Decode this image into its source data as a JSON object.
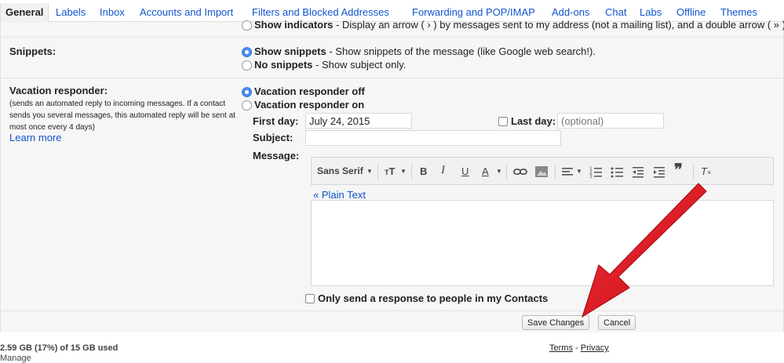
{
  "tabs": [
    {
      "label": "General",
      "active": true
    },
    {
      "label": "Labels"
    },
    {
      "label": "Inbox"
    },
    {
      "label": "Accounts and Import"
    },
    {
      "label": "Filters and Blocked Addresses"
    },
    {
      "label": "Forwarding and POP/IMAP"
    },
    {
      "label": "Add-ons"
    },
    {
      "label": "Chat"
    },
    {
      "label": "Labs"
    },
    {
      "label": "Offline"
    },
    {
      "label": "Themes"
    }
  ],
  "indicators": {
    "option_label": "Show indicators",
    "option_desc": " - Display an arrow ( › ) by messages sent to my address (not a mailing list), and a double arrow ( » ) b"
  },
  "snippets": {
    "title": "Snippets:",
    "show_label": "Show snippets",
    "show_desc": " - Show snippets of the message (like Google web search!).",
    "none_label": "No snippets",
    "none_desc": " - Show subject only."
  },
  "vacation": {
    "title": "Vacation responder:",
    "description": "(sends an automated reply to incoming messages. If a contact sends you several messages, this automated reply will be sent at most once every 4 days)",
    "learn_more": "Learn more",
    "off_label": "Vacation responder off",
    "on_label": "Vacation responder on",
    "first_day_label": "First day:",
    "first_day_value": "July 24, 2015",
    "last_day_label": "Last day:",
    "last_day_placeholder": "(optional)",
    "subject_label": "Subject:",
    "subject_value": "",
    "message_label": "Message:",
    "font_name": "Sans Serif",
    "plain_text_link": "« Plain Text",
    "contacts_only_label": "Only send a response to people in my Contacts"
  },
  "actions": {
    "save_label": "Save Changes",
    "cancel_label": "Cancel"
  },
  "footer": {
    "storage": "2.59 GB (17%) of 15 GB used",
    "manage": "Manage",
    "terms": "Terms",
    "separator": " - ",
    "privacy": "Privacy"
  },
  "colors": {
    "link": "#1155cc",
    "accent_radio": "#4a8af4",
    "annotation_arrow": "#e0141e",
    "panel_bg": "#f6f6f6"
  }
}
